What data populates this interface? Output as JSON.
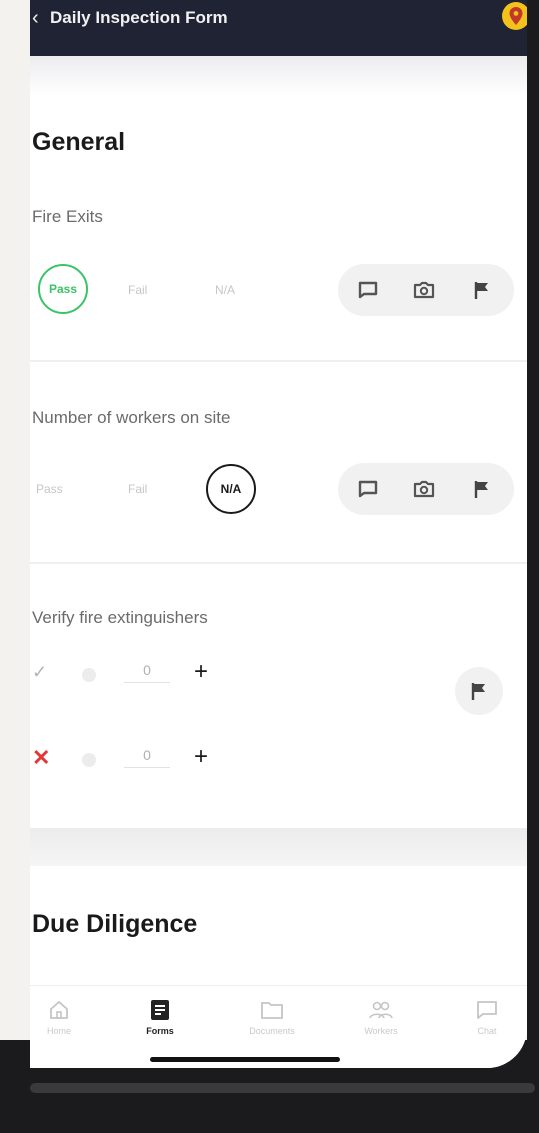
{
  "header": {
    "back_glyph": "‹",
    "title": "Daily Inspection Form",
    "location_icon": "map-pin-icon",
    "accent": "#f3c21b",
    "background": "#1f2333"
  },
  "sections": [
    {
      "title": "General",
      "questions": [
        {
          "label": "Fire Exits",
          "options": [
            "Pass",
            "Fail",
            "N/A"
          ],
          "selected": "Pass",
          "actions": [
            "comment-icon",
            "camera-icon",
            "flag-icon"
          ]
        },
        {
          "label": "Number of workers on site",
          "options": [
            "Pass",
            "Fail",
            "N/A"
          ],
          "selected": "N/A",
          "actions": [
            "comment-icon",
            "camera-icon",
            "flag-icon"
          ]
        },
        {
          "label": "Verify fire extinguishers",
          "counters": [
            {
              "mark": "✓",
              "value": "0"
            },
            {
              "mark": "✕",
              "value": "0"
            }
          ],
          "actions": [
            "flag-icon"
          ]
        }
      ]
    },
    {
      "title": "Due Diligence"
    }
  ],
  "tabbar": {
    "items": [
      {
        "label": "Home",
        "icon": "home-icon"
      },
      {
        "label": "Forms",
        "icon": "forms-icon",
        "active": true
      },
      {
        "label": "Documents",
        "icon": "folder-icon"
      },
      {
        "label": "Workers",
        "icon": "workers-icon"
      },
      {
        "label": "Chat",
        "icon": "chat-icon"
      }
    ]
  },
  "colors": {
    "pass": "#39c465",
    "fail_mark": "#e23838",
    "active_tab": "#222222"
  }
}
